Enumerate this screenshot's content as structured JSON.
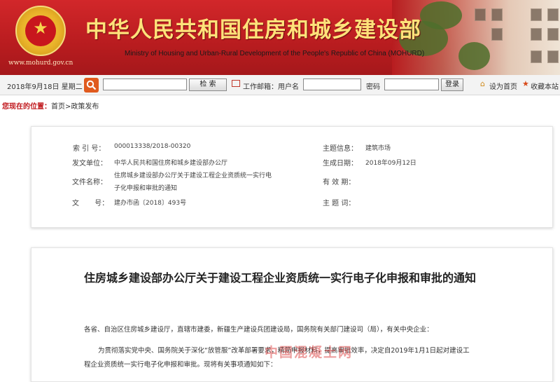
{
  "header": {
    "site_title": "中华人民共和国住房和城乡建设部",
    "site_title_en": "Ministry of Housing and Urban-Rural Development of the People's Republic of China (MOHURD)",
    "site_url": "www.mohurd.gov.cn"
  },
  "toolbar": {
    "date": "2018年9月18日  星期二",
    "search_button": "检  索",
    "mail_label": "工作邮箱：用户名",
    "password_label": "密码",
    "login_button": "登录",
    "set_home": "设为首页",
    "favorite": "收藏本站"
  },
  "breadcrumb": {
    "here": "您现在的位置：",
    "path": "首页>政策发布"
  },
  "info": {
    "index_label": "索 引 号：",
    "index_value": "000013338/2018-00320",
    "issuer_label": "发文单位：",
    "issuer_value": "中华人民共和国住房和城乡建设部办公厅",
    "docname_label": "文件名称：",
    "docname_line1": "住房城乡建设部办公厅关于建设工程企业资质统一实行电",
    "docname_line2": "子化申报和审批的通知",
    "docno_label": "文       号：",
    "docno_value": "建办市函〔2018〕493号",
    "subject_label": "主题信息：",
    "subject_value": "建筑市场",
    "date_label": "生成日期：",
    "date_value": "2018年09月12日",
    "validity_label": "有 效 期：",
    "keywords_label": "主 题 词："
  },
  "article": {
    "title": "住房城乡建设部办公厅关于建设工程企业资质统一实行电子化申报和审批的通知",
    "para1": "各省、自治区住房城乡建设厅，直辖市建委，新疆生产建设兵团建设局，国务院有关部门建设司（局），有关中央企业：",
    "para2_line1": "为贯彻落实党中央、国务院关于深化“放管服”改革部署要求，精简申报材料，提高审批效率，决定自2019年1月1日起对建设工",
    "para2_line2": "程企业资质统一实行电子化申报和审批。现将有关事项通知如下："
  },
  "watermark": "中国混凝土网",
  "colors": {
    "banner_red": "#b81c1f",
    "title_gold": "#ffe27a",
    "accent_red": "#c0181d"
  }
}
